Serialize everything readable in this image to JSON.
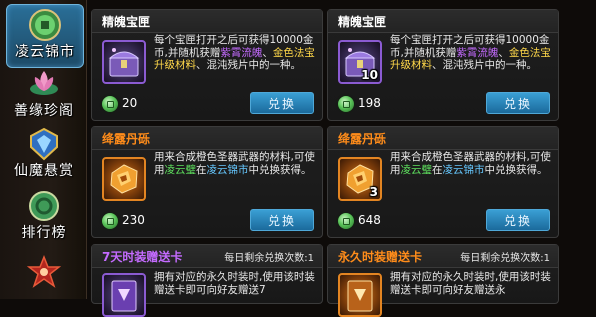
{
  "sidebar": {
    "items": [
      {
        "label": "凌云锦市",
        "icon": "jade-coin-icon",
        "active": true
      },
      {
        "label": "善缘珍阁",
        "icon": "lotus-icon",
        "active": false
      },
      {
        "label": "仙魔悬赏",
        "icon": "crystal-shield-icon",
        "active": false
      },
      {
        "label": "排行榜",
        "icon": "jade-medal-icon",
        "active": false
      },
      {
        "label": "",
        "icon": "demon-star-icon",
        "active": false
      }
    ]
  },
  "cards": [
    {
      "title": "精魄宝匣",
      "title_color": "#ffffff",
      "desc_parts": [
        {
          "text": "每个宝匣打开之后可获得10000金币,并随机获赠",
          "cls": ""
        },
        {
          "text": "紫霄流魄",
          "cls": "hl-purple"
        },
        {
          "text": "、",
          "cls": ""
        },
        {
          "text": "金色法宝升级材料",
          "cls": "hl-yellow"
        },
        {
          "text": "、混沌残片中的一种。",
          "cls": ""
        }
      ],
      "price": "20",
      "button": "兑换",
      "count": "",
      "item_icon": "treasure-chest-icon"
    },
    {
      "title": "精魄宝匣",
      "title_color": "#ffffff",
      "desc_parts": [
        {
          "text": "每个宝匣打开之后可获得10000金币,并随机获赠",
          "cls": ""
        },
        {
          "text": "紫霄流魄",
          "cls": "hl-purple"
        },
        {
          "text": "、",
          "cls": ""
        },
        {
          "text": "金色法宝升级材料",
          "cls": "hl-yellow"
        },
        {
          "text": "、混沌残片中的一种。",
          "cls": ""
        }
      ],
      "price": "198",
      "button": "兑换",
      "count": "10",
      "item_icon": "treasure-chest-icon"
    },
    {
      "title": "绛露丹砾",
      "title_color": "#ff8c1a",
      "desc_parts": [
        {
          "text": "用来合成橙色圣器武器的材料,可使用",
          "cls": ""
        },
        {
          "text": "凌云璧",
          "cls": "hl-green"
        },
        {
          "text": "在",
          "cls": ""
        },
        {
          "text": "凌云锦市",
          "cls": "hl-blue"
        },
        {
          "text": "中兑换获得。",
          "cls": ""
        }
      ],
      "price": "230",
      "button": "兑换",
      "count": "",
      "item_icon": "elixir-fragment-icon"
    },
    {
      "title": "绛露丹砾",
      "title_color": "#ff8c1a",
      "desc_parts": [
        {
          "text": "用来合成橙色圣器武器的材料,可使用",
          "cls": ""
        },
        {
          "text": "凌云璧",
          "cls": "hl-green"
        },
        {
          "text": "在",
          "cls": ""
        },
        {
          "text": "凌云锦市",
          "cls": "hl-blue"
        },
        {
          "text": "中兑换获得。",
          "cls": ""
        }
      ],
      "price": "648",
      "button": "兑换",
      "count": "3",
      "item_icon": "elixir-fragment-icon"
    },
    {
      "title": "7天时装赠送卡",
      "title_color": "#c46bff",
      "daily_limit": "每日剩余兑换次数:1",
      "desc_parts": [
        {
          "text": "拥有对应的永久时装时,使用该时装赠送卡即可向好友赠送7",
          "cls": ""
        }
      ],
      "item_icon": "fashion-card-icon"
    },
    {
      "title": "永久时装赠送卡",
      "title_color": "#ff8c1a",
      "daily_limit": "每日剩余兑换次数:1",
      "desc_parts": [
        {
          "text": "拥有对应的永久时装时,使用该时装赠送卡即可向好友赠送永",
          "cls": ""
        }
      ],
      "item_icon": "fashion-card-icon"
    }
  ],
  "colors": {
    "accent_blue": "#2a7fb5",
    "purple_quality": "#8b5bd2",
    "orange_quality": "#e38522"
  }
}
